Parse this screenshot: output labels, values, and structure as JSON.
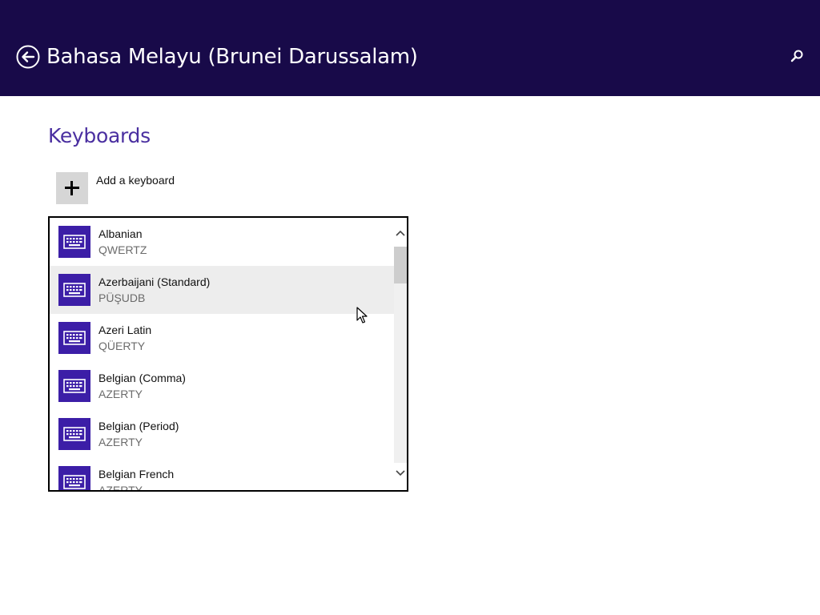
{
  "header": {
    "title": "Bahasa Melayu (Brunei Darussalam)",
    "back_icon": "back-arrow-circle-icon",
    "search_icon": "search-icon",
    "background_color": "#180a49"
  },
  "section": {
    "title": "Keyboards",
    "title_color": "#4a2fa0"
  },
  "add_keyboard": {
    "label": "Add a keyboard",
    "icon": "plus-icon"
  },
  "keyboards": [
    {
      "name": "Albanian",
      "layout": "QWERTZ"
    },
    {
      "name": "Azerbaijani (Standard)",
      "layout": "PÜŞUDB"
    },
    {
      "name": "Azeri Latin",
      "layout": "QÜERTY"
    },
    {
      "name": "Belgian (Comma)",
      "layout": "AZERTY"
    },
    {
      "name": "Belgian (Period)",
      "layout": "AZERTY"
    },
    {
      "name": "Belgian French",
      "layout": "AZERTY"
    }
  ],
  "keyboard_icon": "keyboard-icon",
  "accent_color": "#3c1ea7",
  "hovered_index": 1,
  "scroll_position": 0.0
}
